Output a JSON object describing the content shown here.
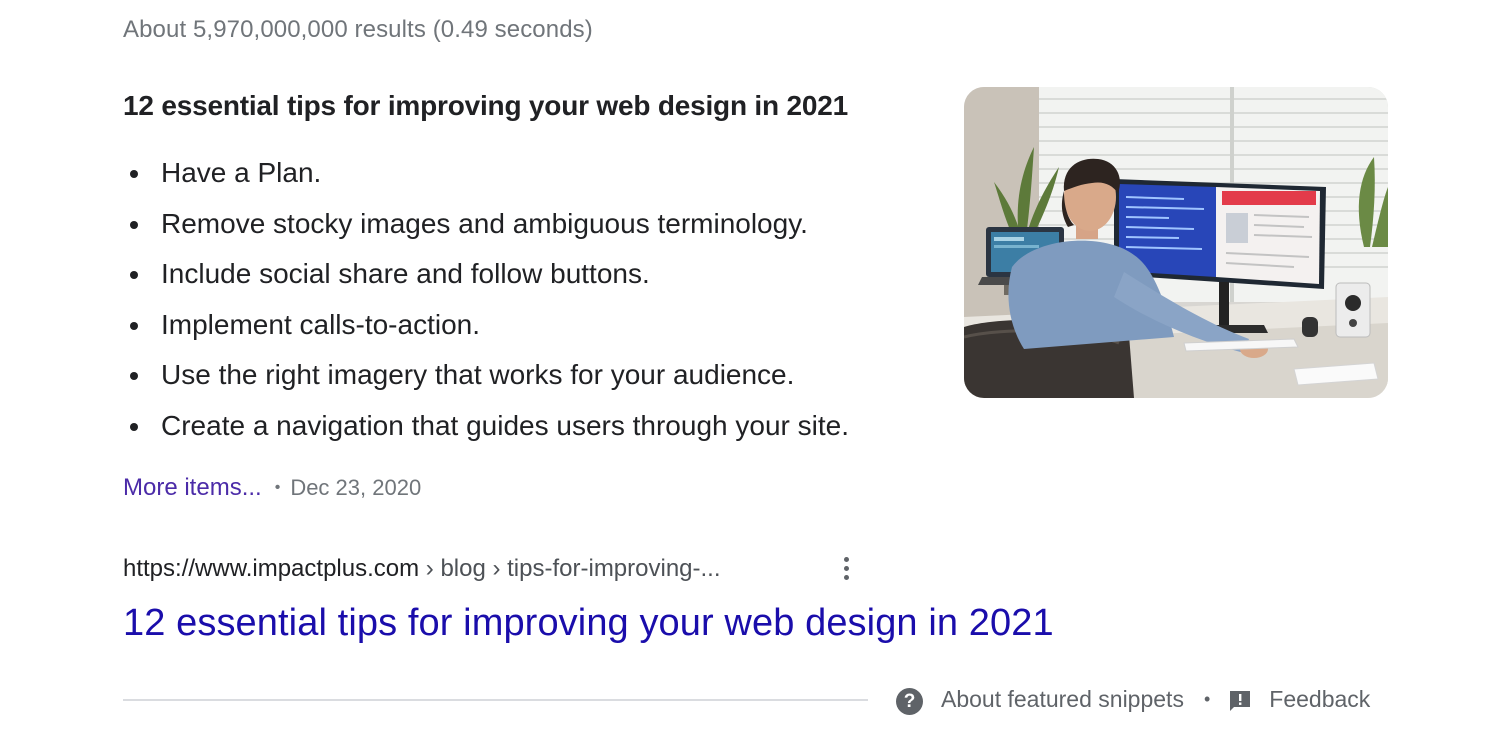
{
  "results_stats": "About 5,970,000,000 results (0.49 seconds)",
  "snippet": {
    "heading": "12 essential tips for improving your web design in 2021",
    "items": [
      "Have a Plan.",
      "Remove stocky images and ambiguous terminology.",
      "Include social share and follow buttons.",
      "Implement calls-to-action.",
      "Use the right imagery that works for your audience.",
      "Create a navigation that guides users through your site."
    ],
    "more_link": "More items...",
    "separator": "•",
    "date": "Dec 23, 2020",
    "thumbnail_icon": "person-at-computer-photo"
  },
  "source": {
    "domain": "https://www.impactplus.com",
    "breadcrumb": " › blog › tips-for-improving-...",
    "menu_icon": "more-vert-icon"
  },
  "result": {
    "title": "12 essential tips for improving your web design in 2021"
  },
  "footer": {
    "help_icon_glyph": "?",
    "about_label": "About featured snippets",
    "separator": "•",
    "feedback_label": "Feedback"
  },
  "colors": {
    "link_visited": "#4b2ba8",
    "link_title": "#1a0dab",
    "text_primary": "#202124",
    "text_secondary": "#70757a",
    "divider": "#dadce0"
  }
}
